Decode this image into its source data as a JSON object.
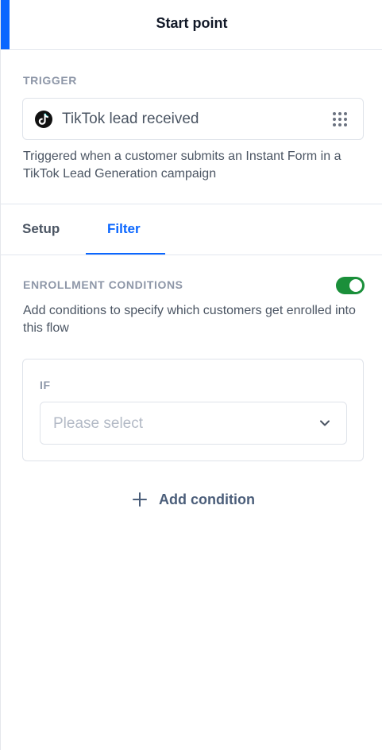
{
  "header": {
    "title": "Start point"
  },
  "trigger": {
    "section_label": "TRIGGER",
    "name": "TikTok lead received",
    "icon": "tiktok-icon",
    "description": "Triggered when a customer submits an Instant Form in a TikTok Lead Generation campaign"
  },
  "tabs": [
    {
      "label": "Setup",
      "active": false
    },
    {
      "label": "Filter",
      "active": true
    }
  ],
  "enrollment": {
    "section_label": "ENROLLMENT CONDITIONS",
    "enabled": true,
    "description": "Add conditions to specify which customers get enrolled into this flow",
    "condition": {
      "if_label": "IF",
      "select_placeholder": "Please select"
    },
    "add_condition_label": "Add condition"
  },
  "colors": {
    "accent": "#0a66ff",
    "toggle_on": "#1a8f3a"
  }
}
